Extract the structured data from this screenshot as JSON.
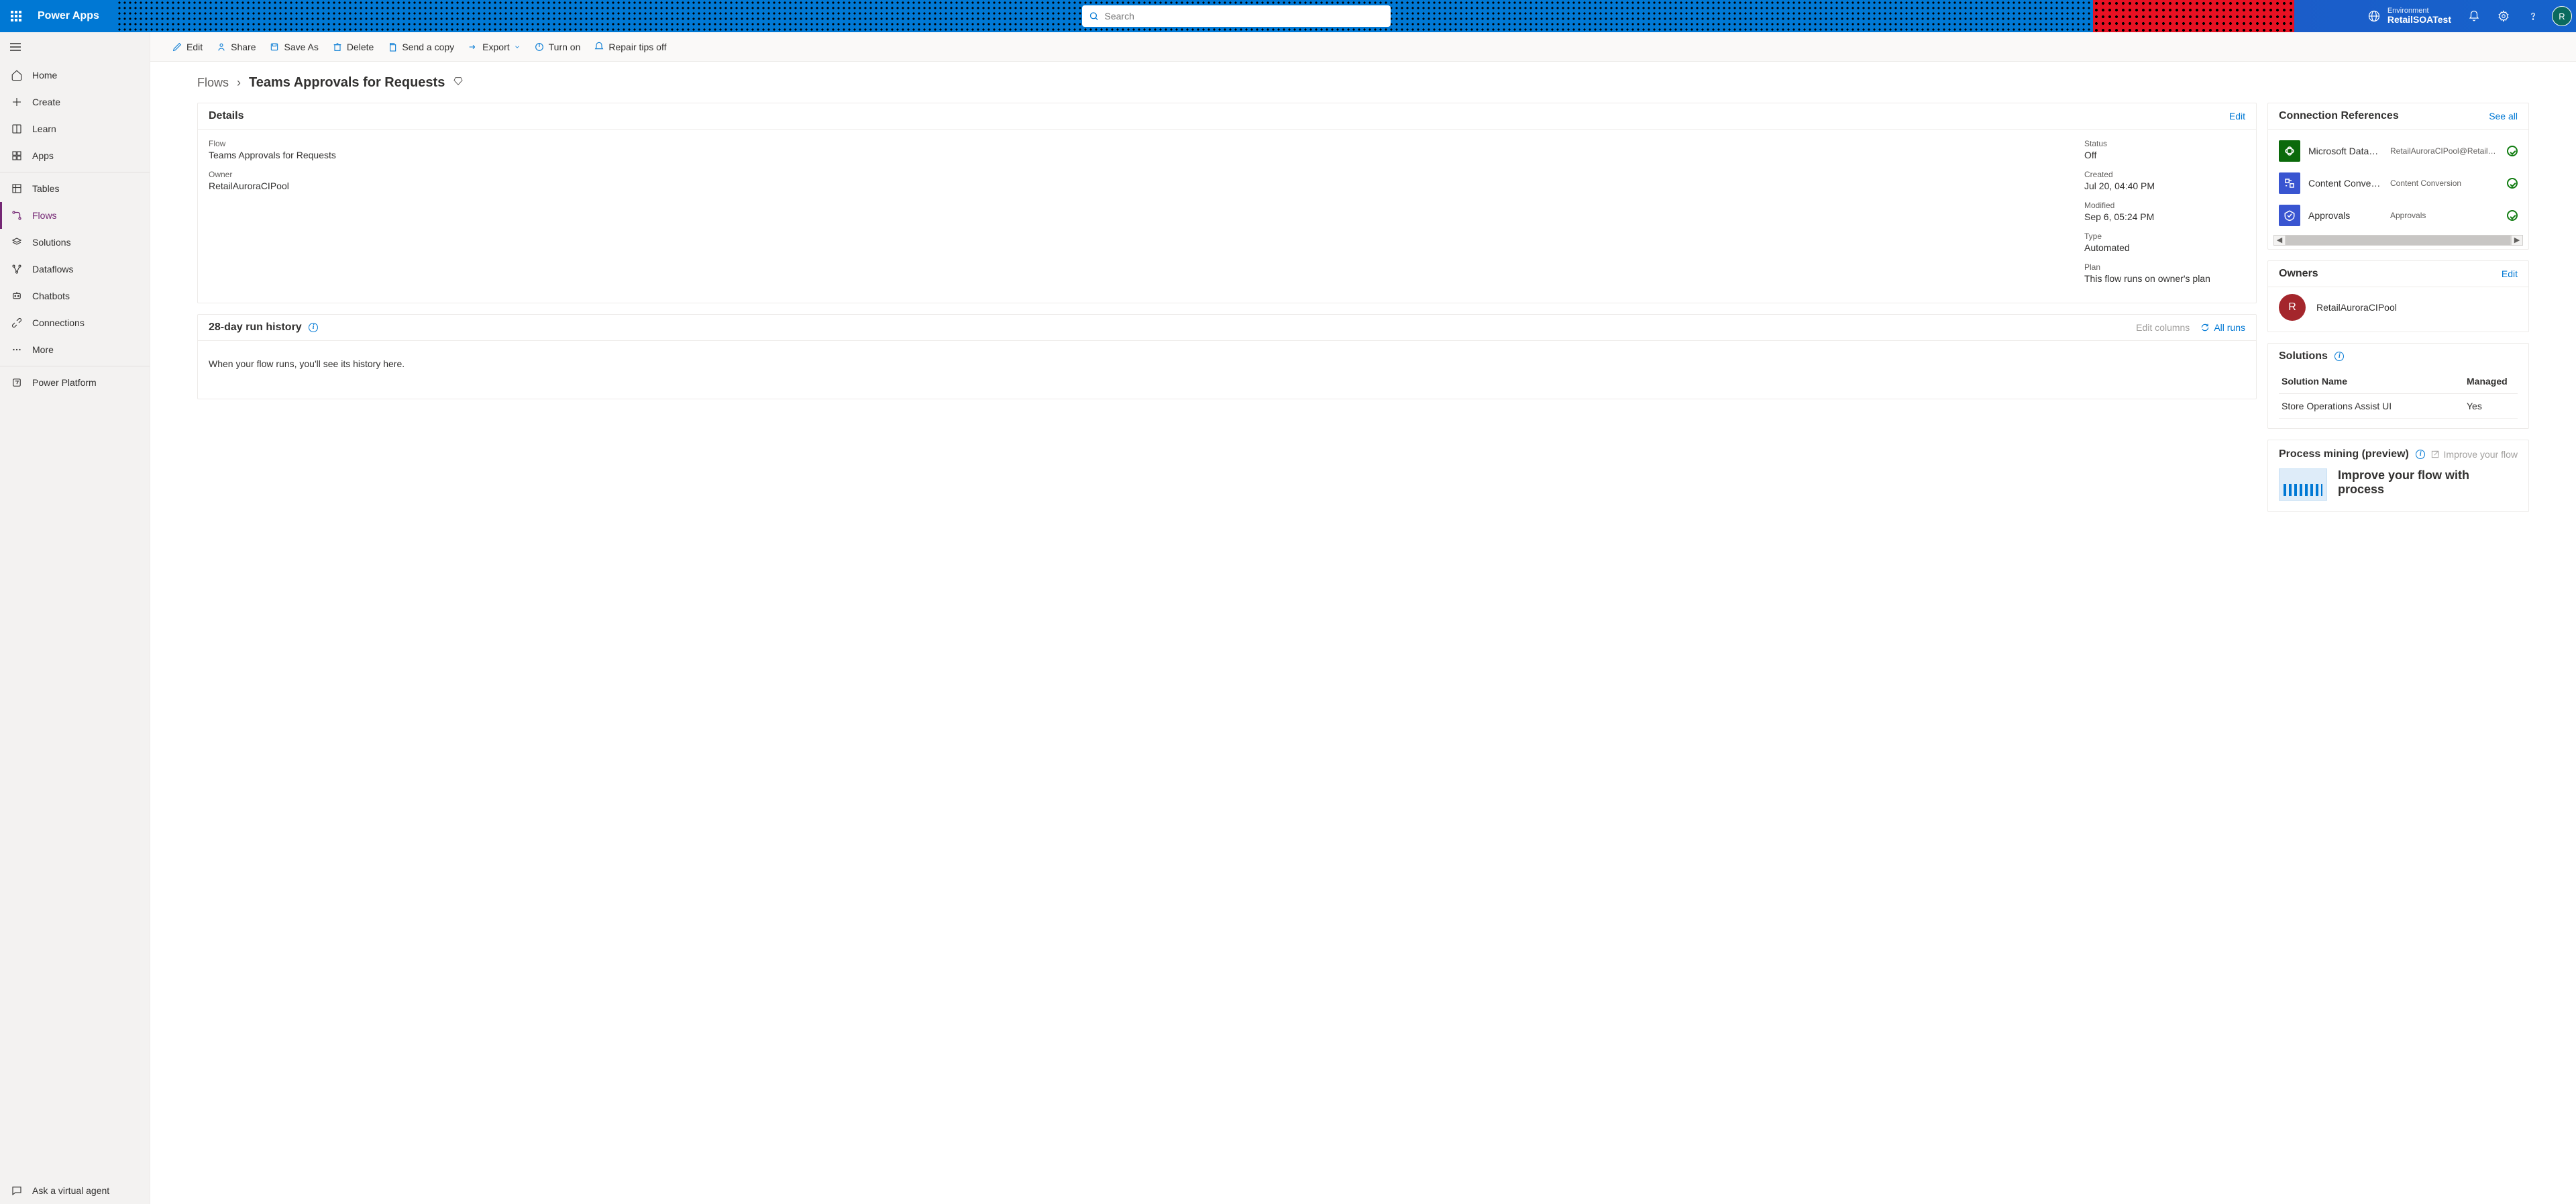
{
  "header": {
    "app_title": "Power Apps",
    "search_placeholder": "Search",
    "environment_label": "Environment",
    "environment_name": "RetailSOATest",
    "avatar_initial": "R"
  },
  "sidebar": {
    "items": [
      {
        "label": "Home"
      },
      {
        "label": "Create"
      },
      {
        "label": "Learn"
      },
      {
        "label": "Apps"
      },
      {
        "label": "Tables"
      },
      {
        "label": "Flows"
      },
      {
        "label": "Solutions"
      },
      {
        "label": "Dataflows"
      },
      {
        "label": "Chatbots"
      },
      {
        "label": "Connections"
      },
      {
        "label": "More"
      }
    ],
    "power_platform": "Power Platform",
    "ask_agent": "Ask a virtual agent"
  },
  "command_bar": {
    "edit": "Edit",
    "share": "Share",
    "save_as": "Save As",
    "delete": "Delete",
    "send_copy": "Send a copy",
    "export": "Export",
    "turn_on": "Turn on",
    "repair_tips": "Repair tips off"
  },
  "breadcrumb": {
    "root": "Flows",
    "current": "Teams Approvals for Requests"
  },
  "details": {
    "title": "Details",
    "edit": "Edit",
    "flow_label": "Flow",
    "flow_value": "Teams Approvals for Requests",
    "owner_label": "Owner",
    "owner_value": "RetailAuroraCIPool",
    "status_label": "Status",
    "status_value": "Off",
    "created_label": "Created",
    "created_value": "Jul 20, 04:40 PM",
    "modified_label": "Modified",
    "modified_value": "Sep 6, 05:24 PM",
    "type_label": "Type",
    "type_value": "Automated",
    "plan_label": "Plan",
    "plan_value": "This flow runs on owner's plan"
  },
  "history": {
    "title": "28-day run history",
    "edit_columns": "Edit columns",
    "all_runs": "All runs",
    "empty": "When your flow runs, you'll see its history here."
  },
  "connections": {
    "title": "Connection References",
    "see_all": "See all",
    "items": [
      {
        "name": "Microsoft Dataverse",
        "sub": "RetailAuroraCIPool@RetailCPO"
      },
      {
        "name": "Content Conversion",
        "sub": "Content Conversion"
      },
      {
        "name": "Approvals",
        "sub": "Approvals"
      }
    ]
  },
  "owners_card": {
    "title": "Owners",
    "edit": "Edit",
    "initial": "R",
    "name": "RetailAuroraCIPool"
  },
  "solutions_card": {
    "title": "Solutions",
    "col_name": "Solution Name",
    "col_managed": "Managed",
    "row_name": "Store Operations Assist UI",
    "row_managed": "Yes"
  },
  "process_mining": {
    "title": "Process mining (preview)",
    "improve_link": "Improve your flow",
    "body_text": "Improve your flow with process"
  }
}
